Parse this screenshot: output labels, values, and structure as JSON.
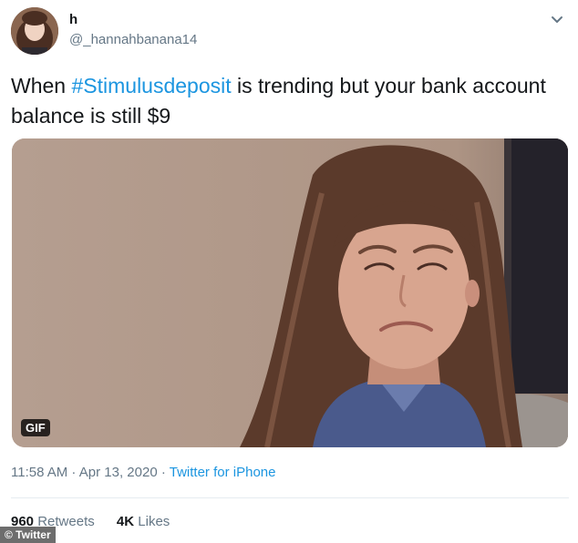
{
  "user": {
    "display_name": "h",
    "handle": "@_hannahbanana14"
  },
  "tweet": {
    "text_before": "When ",
    "hashtag": "#Stimulusdeposit",
    "text_after": " is trending but your bank account balance is still $9"
  },
  "media": {
    "badge": "GIF"
  },
  "meta": {
    "time": "11:58 AM",
    "separator": " · ",
    "date": "Apr 13, 2020",
    "source": "Twitter for iPhone"
  },
  "stats": {
    "retweets_count": "960",
    "retweets_label": "Retweets",
    "likes_count": "4K",
    "likes_label": "Likes"
  },
  "watermark": "© Twitter",
  "icons": {
    "caret": "chevron-down-icon"
  }
}
